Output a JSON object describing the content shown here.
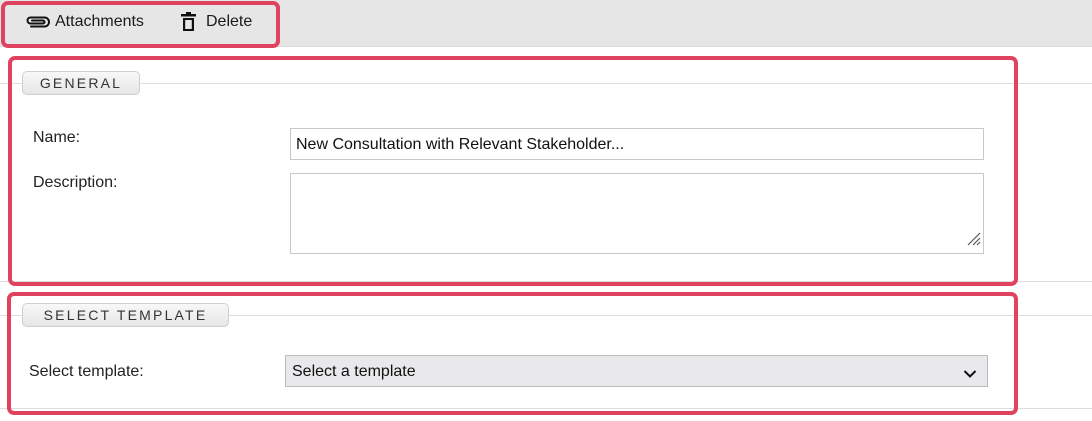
{
  "toolbar": {
    "attachments_label": "Attachments",
    "delete_label": "Delete"
  },
  "general": {
    "legend": "GENERAL",
    "name_label": "Name:",
    "name_value": "New Consultation with Relevant Stakeholder...",
    "description_label": "Description:",
    "description_value": ""
  },
  "template": {
    "legend": "SELECT TEMPLATE",
    "select_label": "Select template:",
    "selected_value": "Select a template"
  },
  "icons": [
    "paperclip-icon",
    "trash-icon",
    "resize-grip-icon",
    "chevron-down-icon"
  ],
  "colors": {
    "highlight": "#e0435f",
    "toolbar_bg": "#e6e6e6",
    "select_bg": "#e9e9ec"
  }
}
